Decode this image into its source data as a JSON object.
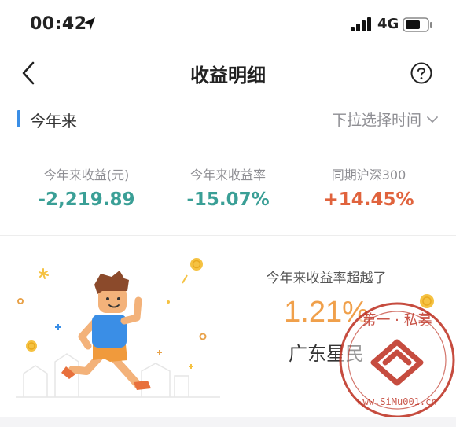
{
  "status_bar": {
    "time": "00:42",
    "network": "4G"
  },
  "nav": {
    "title": "收益明细"
  },
  "section": {
    "title": "今年来",
    "picker_label": "下拉选择时间"
  },
  "stats": [
    {
      "label": "今年来收益(元)",
      "value": "-2,219.89"
    },
    {
      "label": "今年来收益率",
      "value": "-15.07%"
    },
    {
      "label": "同期沪深300",
      "value": "+14.45%"
    }
  ],
  "promo": {
    "caption": "今年来收益率超越了",
    "percent": "1.21%",
    "region": "广东星民"
  },
  "watermark": {
    "text": "第一私募 · www.SiMu001.cn"
  },
  "colors": {
    "negative": "#3a9f96",
    "positive": "#e0633d",
    "accent": "#3a8ee6",
    "promo_percent": "#f0a04b",
    "watermark": "#c0392b"
  },
  "icons": [
    "location-arrow-icon",
    "signal-icon",
    "battery-icon",
    "back-chevron-icon",
    "help-circle-icon",
    "chevron-down-icon"
  ]
}
